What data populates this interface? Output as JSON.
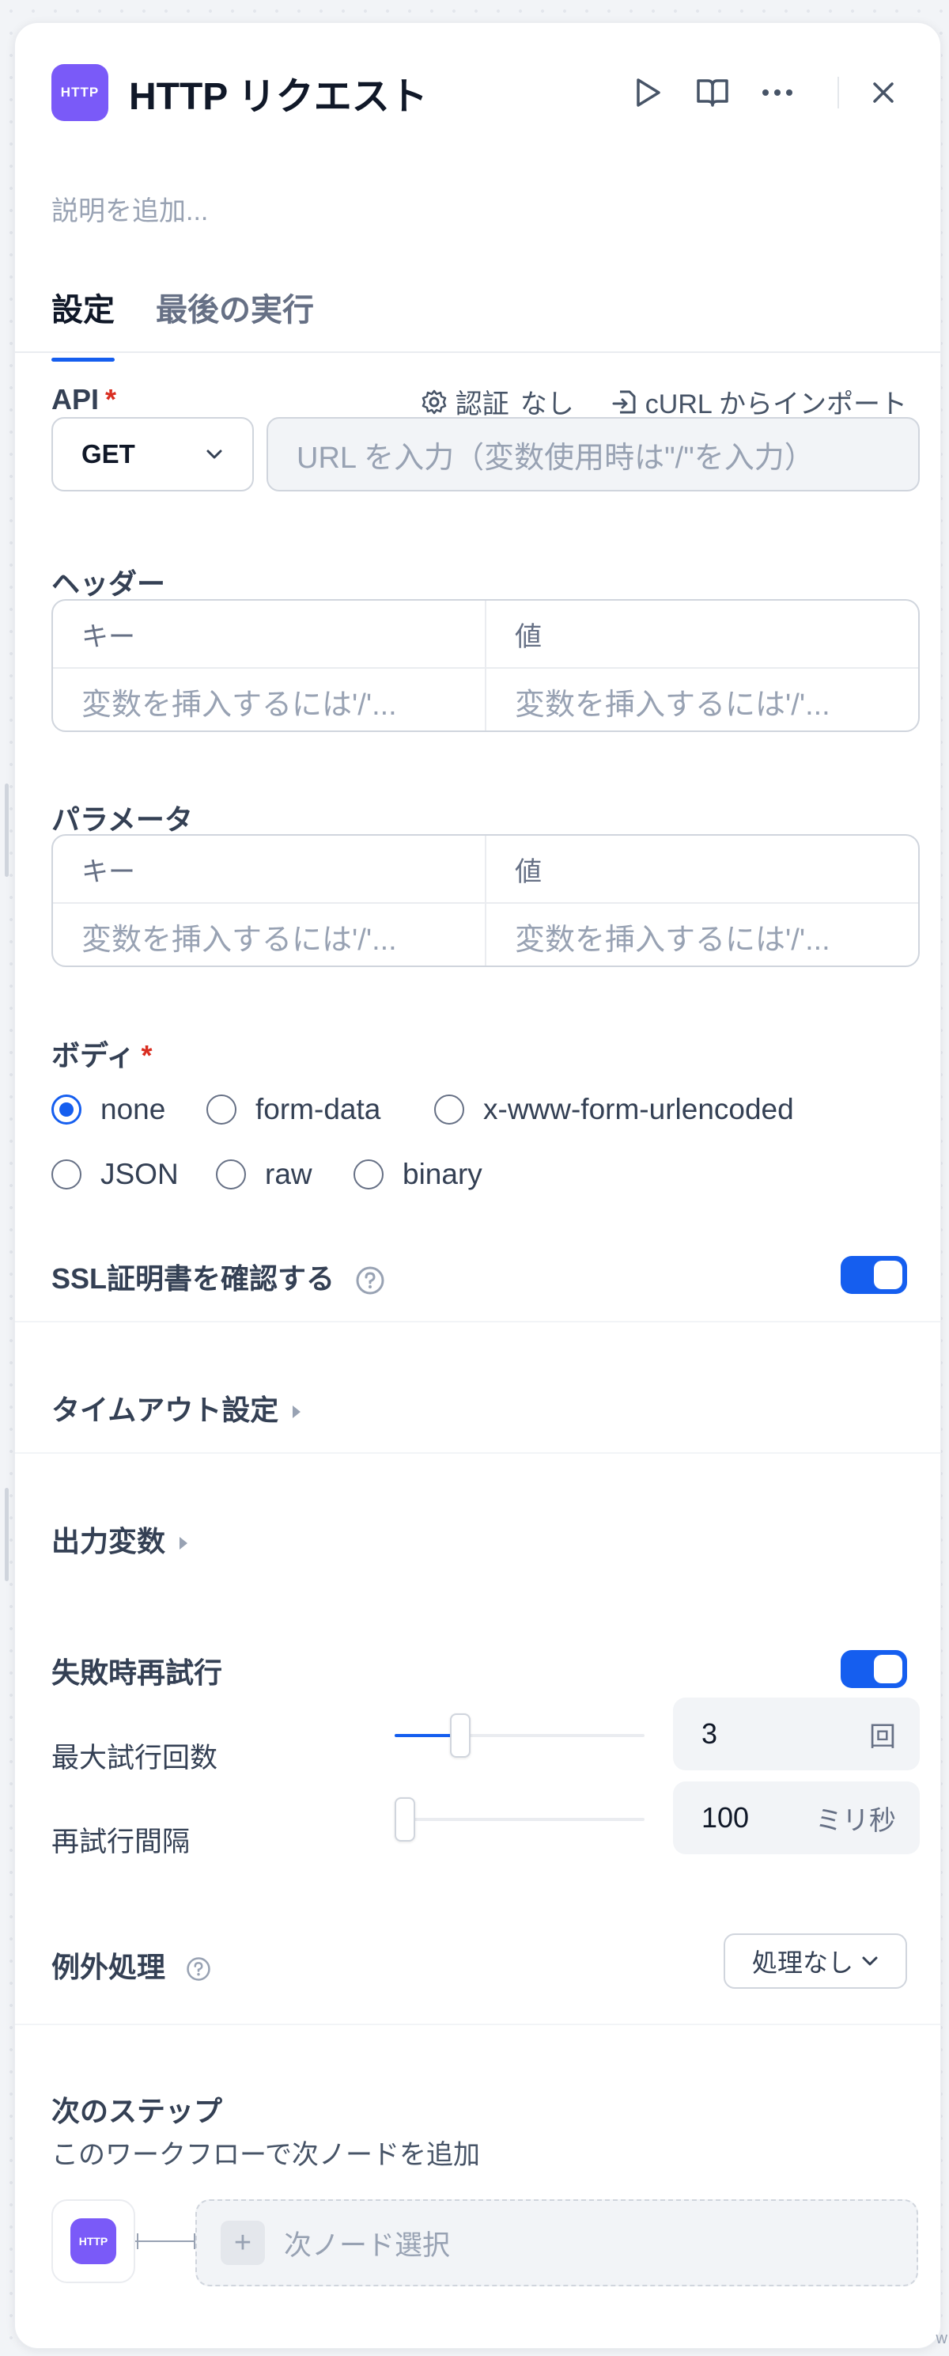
{
  "node": {
    "icon_text": "HTTP",
    "title": "HTTP リクエスト",
    "description_placeholder": "説明を追加..."
  },
  "header_actions": [
    "run-icon",
    "docs-icon",
    "more-icon",
    "close-icon"
  ],
  "tabs": [
    {
      "label": "設定",
      "active": true
    },
    {
      "label": "最後の実行",
      "active": false
    }
  ],
  "api": {
    "label": "API",
    "required_mark": "*",
    "auth_label": "認証",
    "auth_value": "なし",
    "curl_label": "cURL からインポート",
    "method": "GET",
    "url_placeholder": "URL を入力（変数使用時は\"/\"を入力）"
  },
  "headers": {
    "label": "ヘッダー",
    "key_header": "キー",
    "value_header": "値",
    "key_placeholder": "変数を挿入するには'/'...",
    "value_placeholder": "変数を挿入するには'/'..."
  },
  "params": {
    "label": "パラメータ",
    "key_header": "キー",
    "value_header": "値",
    "key_placeholder": "変数を挿入するには'/'...",
    "value_placeholder": "変数を挿入するには'/'..."
  },
  "body": {
    "label": "ボディ",
    "required_mark": "*",
    "options": [
      "none",
      "form-data",
      "x-www-form-urlencoded",
      "JSON",
      "raw",
      "binary"
    ],
    "selected": "none"
  },
  "ssl": {
    "label": "SSL証明書を確認する",
    "enabled": true
  },
  "timeout": {
    "label": "タイムアウト設定"
  },
  "output_vars": {
    "label": "出力変数"
  },
  "retry": {
    "label": "失敗時再試行",
    "enabled": true,
    "max_retries_label": "最大試行回数",
    "max_retries_value": "3",
    "max_retries_unit": "回",
    "max_retries_slider_fraction": 0.24,
    "interval_label": "再試行間隔",
    "interval_value": "100",
    "interval_unit": "ミリ秒",
    "interval_slider_fraction": 0.0
  },
  "error_handling": {
    "label": "例外処理",
    "value": "処理なし"
  },
  "next_step": {
    "label": "次のステップ",
    "description": "このワークフローで次ノードを追加",
    "node_icon_text": "HTTP",
    "select_label": "次ノード選択"
  },
  "colors": {
    "accent": "#155eef",
    "node_purple": "#7a5af8",
    "required": "#d92d20"
  },
  "corner_text": "w"
}
